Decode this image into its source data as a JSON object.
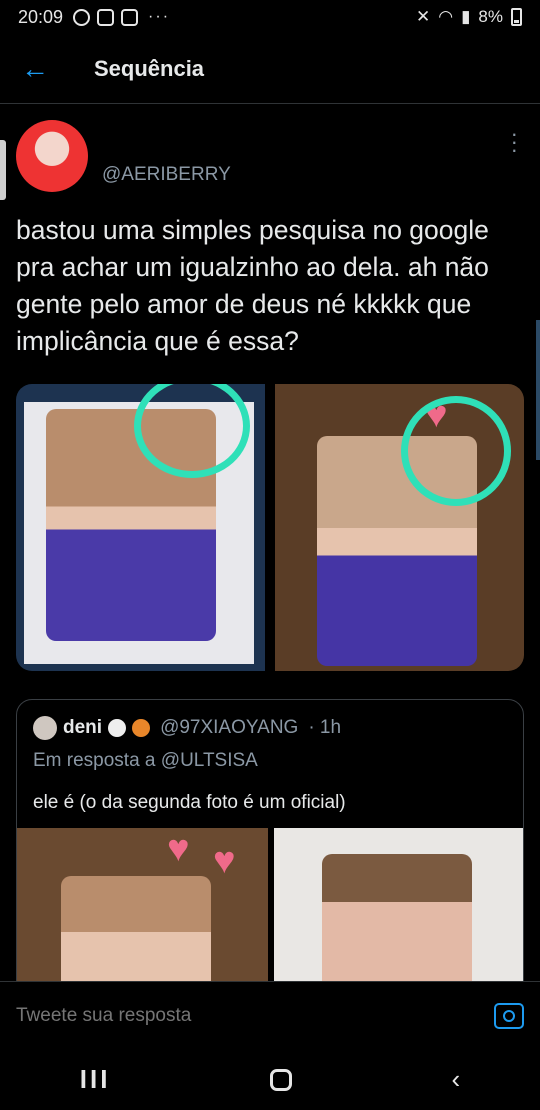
{
  "status_bar": {
    "time": "20:09",
    "battery": "8%",
    "overflow_dots": "···",
    "icons": [
      "whatsapp-icon",
      "twitch-icon",
      "instagram-icon",
      "mute-icon",
      "wifi-icon",
      "signal-icon",
      "battery-icon"
    ]
  },
  "header": {
    "title": "Sequência",
    "back_icon": "arrow-left-icon"
  },
  "tweet": {
    "handle": "@AERIBERRY",
    "text": "bastou uma simples pesquisa no google pra achar um igualzinho ao dela. ah não gente pelo amor de deus né kkkkk que implicância que é essa?"
  },
  "quoted_tweet": {
    "name": "deni",
    "handle": "@97XIAOYANG",
    "time": "· 1h",
    "reply_to": "Em resposta a @ULTSISA",
    "text": "ele é (o da segunda foto é um oficial)"
  },
  "reply_bar": {
    "placeholder": "Tweete sua resposta"
  },
  "nav": {
    "recents": "III",
    "back": "‹"
  },
  "colors": {
    "accent": "#1d9bf0",
    "background": "#000000",
    "circle": "#2fe0b8"
  }
}
